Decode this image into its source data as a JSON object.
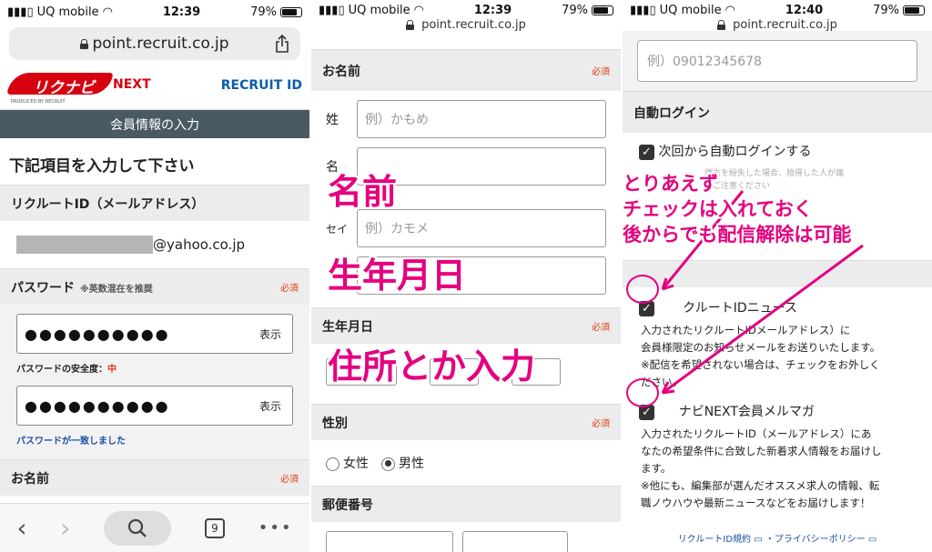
{
  "panel1": {
    "status": {
      "carrier": "UQ mobile",
      "time": "12:39",
      "battery": "79%"
    },
    "url": "point.recruit.co.jp",
    "logo_main": "リクナビ",
    "logo_next": "NEXT",
    "logo_produced": "PRODUCED BY RECRUIT",
    "logo_recruit_id": "RECRUIT ID",
    "header_bar": "会員情報の入力",
    "heading": "下記項目を入力して下さい",
    "recruit_id_label": "リクルートID（メールアドレス）",
    "email_suffix": "@yahoo.co.jp",
    "password_label": "パスワード",
    "password_hint": "※英数混在を推奨",
    "required": "必須",
    "password_mask": "●●●●●●●●●●",
    "show_label": "表示",
    "strength_label": "パスワードの安全度：",
    "strength_value": "中",
    "match_message": "パスワードが一致しました",
    "name_label": "お名前",
    "tab_count": "9"
  },
  "panel2": {
    "status": {
      "carrier": "UQ mobile",
      "time": "12:39",
      "battery": "79%"
    },
    "url": "point.recruit.co.jp",
    "name_label": "お名前",
    "required": "必須",
    "sei_label": "姓",
    "sei_placeholder": "例）かもめ",
    "mei_label": "名",
    "sei_kana_label": "セイ",
    "sei_kana_placeholder": "例）カモメ",
    "birth_label": "生年月日",
    "gender_label": "性別",
    "female": "女性",
    "male": "男性",
    "zip_label": "郵便番号"
  },
  "panel3": {
    "status": {
      "carrier": "UQ mobile",
      "time": "12:40",
      "battery": "79%"
    },
    "url": "point.recruit.co.jp",
    "phone_placeholder": "例）09012345678",
    "auto_login_section": "自動ログイン",
    "auto_login_check": "次回から自動ログインする",
    "faded_note_1": "端末を紛失した場合、拾得した人が端",
    "faded_note_2": "をご注意ください",
    "news_label": "クルートIDニュース",
    "news_note_1": "入力されたリクルートIDメールアドレス）に",
    "news_note_2": "会員様限定のお知らせメールをお送りいたします。",
    "news_note_3": "※配信を希望されない場合は、チェックをお外しく",
    "news_note_4": "ださい。",
    "mag_label": "ナビNEXT会員メルマガ",
    "mag_note_1": "入力されたリクルートID（メールアドレス）にあ",
    "mag_note_2": "なたの希望条件に合致した新着求人情報をお届けし",
    "mag_note_3": "ます。",
    "mag_note_4": "※他にも、編集部が選んだオススメ求人の情報、転",
    "mag_note_5": "職ノウハウや最新ニュースなどをお届けします！",
    "footer_terms": "リクルートID規約",
    "footer_privacy": "・プライバシーポリシー"
  },
  "annotations": {
    "name": "名前",
    "birth": "生年月日",
    "address": "住所とか入力",
    "line1": "とりあえず",
    "line2": "チェックは入れておく",
    "line3": "後からでも配信解除は可能"
  },
  "colors": {
    "accent": "#e4007f",
    "required": "#e8380d",
    "brand_red": "#d7000f",
    "header_bar": "#4a5a63"
  }
}
